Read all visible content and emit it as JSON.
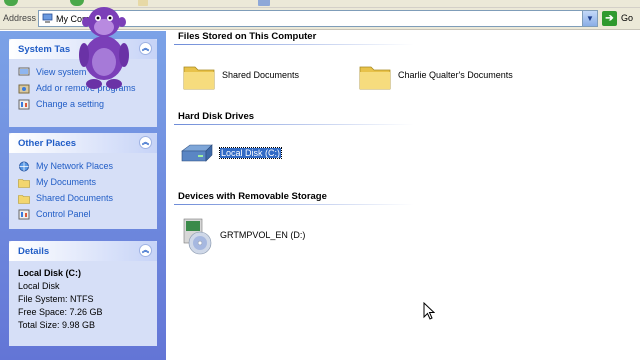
{
  "address": {
    "label": "Address",
    "value": "My Comp",
    "go_label": "Go"
  },
  "left_pane": {
    "system_tasks": {
      "title": "System Tas",
      "items": [
        {
          "label": "View system",
          "icon": "system-info-icon"
        },
        {
          "label": "Add or remove programs",
          "icon": "add-remove-programs-icon"
        },
        {
          "label": "Change a setting",
          "icon": "control-panel-icon"
        }
      ]
    },
    "other_places": {
      "title": "Other Places",
      "items": [
        {
          "label": "My Network Places",
          "icon": "network-places-icon"
        },
        {
          "label": "My Documents",
          "icon": "folder-icon"
        },
        {
          "label": "Shared Documents",
          "icon": "folder-icon"
        },
        {
          "label": "Control Panel",
          "icon": "control-panel-icon"
        }
      ]
    },
    "details": {
      "title": "Details",
      "name": "Local Disk (C:)",
      "type": "Local Disk",
      "file_system": "File System: NTFS",
      "free_space": "Free Space: 7.26 GB",
      "total_size": "Total Size: 9.98 GB"
    }
  },
  "content": {
    "groups": [
      {
        "title": "Files Stored on This Computer",
        "items": [
          {
            "label": "Shared Documents",
            "icon": "folder-icon"
          },
          {
            "label": "Charlie Qualter's Documents",
            "icon": "folder-icon"
          }
        ]
      },
      {
        "title": "Hard Disk Drives",
        "items": [
          {
            "label": "Local Disk (C:)",
            "icon": "hard-disk-icon",
            "selected": true
          }
        ]
      },
      {
        "title": "Devices with Removable Storage",
        "items": [
          {
            "label": "GRTMPVOL_EN (D:)",
            "icon": "cd-drive-icon"
          }
        ]
      }
    ]
  },
  "colors": {
    "task_pane_top": "#7ba2e7",
    "task_pane_bottom": "#6375d6",
    "link_blue": "#215dc6",
    "selection": "#316ac5",
    "folder_yellow": "#f3d66e"
  }
}
